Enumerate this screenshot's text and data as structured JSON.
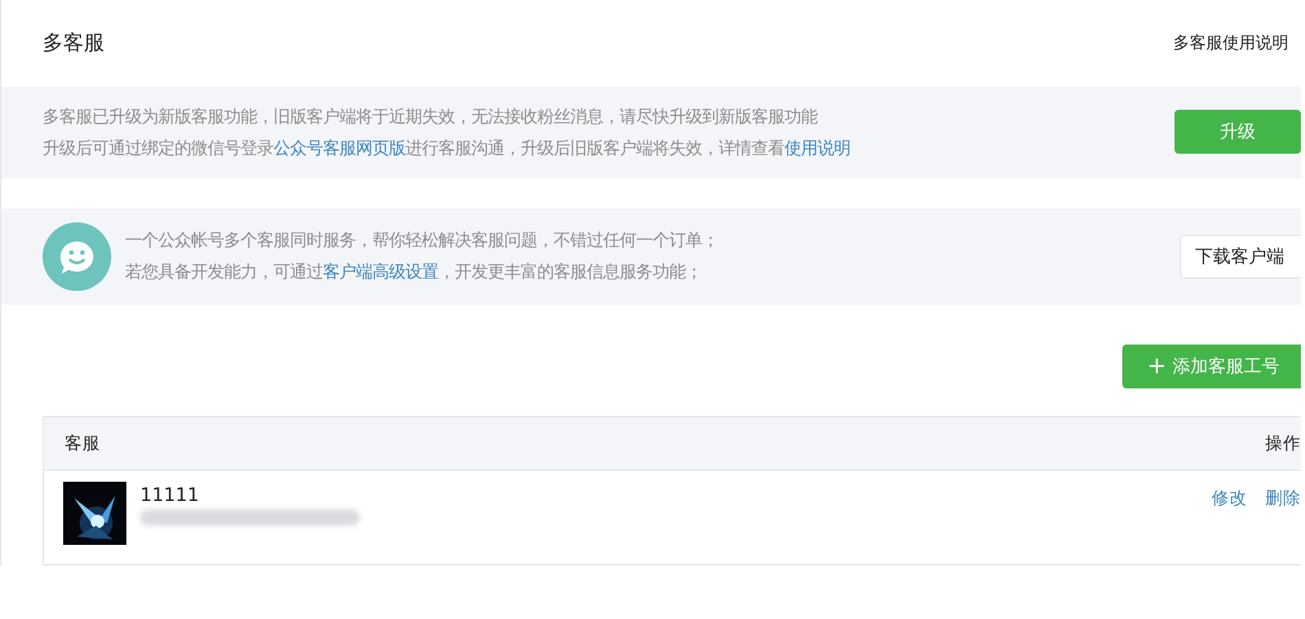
{
  "header": {
    "title": "多客服",
    "help_link": "多客服使用说明"
  },
  "notice": {
    "lines": [
      [
        {
          "kind": "text",
          "text": "多客服已升级为新版客服功能，旧版客户端将于近期失效，无法接收粉丝消息，请尽快升级到新版客服功能"
        }
      ],
      [
        {
          "kind": "text",
          "text": "升级后可通过绑定的微信号登录"
        },
        {
          "kind": "link",
          "text": "公众号客服网页版"
        },
        {
          "kind": "text",
          "text": "进行客服沟通，升级后旧版客户端将失效，详情查看"
        },
        {
          "kind": "link",
          "text": "使用说明"
        }
      ]
    ],
    "button": "升级"
  },
  "intro": {
    "lines": [
      [
        {
          "kind": "text",
          "text": "一个公众帐号多个客服同时服务，帮你轻松解决客服问题，不错过任何一个订单；"
        }
      ],
      [
        {
          "kind": "text",
          "text": "若您具备开发能力，可通过"
        },
        {
          "kind": "link",
          "text": "客户端高级设置"
        },
        {
          "kind": "text",
          "text": "，开发更丰富的客服信息服务功能；"
        }
      ]
    ],
    "button": "下载客户端"
  },
  "add_button": {
    "icon": "+",
    "label": "添加客服工号"
  },
  "table": {
    "columns": [
      "客服",
      "操作"
    ],
    "rows": [
      {
        "name": "11111",
        "actions": [
          "修改",
          "删除"
        ]
      }
    ]
  }
}
